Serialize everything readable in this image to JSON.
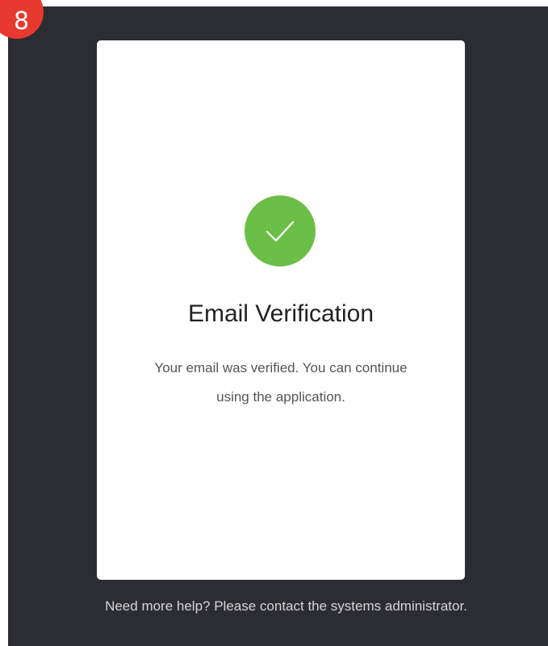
{
  "step_badge": {
    "number": "8",
    "color": "#e8392f"
  },
  "card": {
    "status_icon": "check-circle-icon",
    "status_color": "#6bbf46",
    "title": "Email Verification",
    "message": "Your email was verified. You can continue using the application."
  },
  "footer": {
    "help_text": "Need more help? Please contact the systems administrator."
  },
  "colors": {
    "panel_background": "#2c2c33",
    "card_background": "#ffffff"
  }
}
